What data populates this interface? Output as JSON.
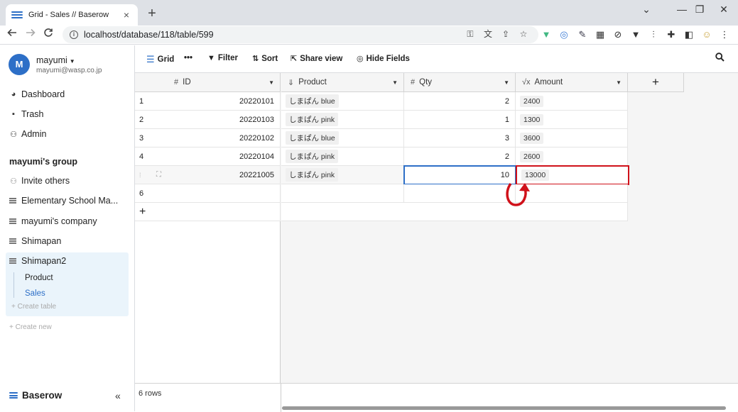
{
  "browser": {
    "tab_title": "Grid - Sales // Baserow",
    "tab_close": "×",
    "new_tab": "+",
    "url": "localhost/database/118/table/599",
    "win_minimize": "—",
    "win_restore": "❐",
    "win_close": "✕",
    "win_chevron": "⌄"
  },
  "sidebar": {
    "avatar_letter": "M",
    "username": "mayumi",
    "email": "mayumi@wasp.co.jp",
    "nav": [
      {
        "label": "Dashboard",
        "icon": "dashboard-icon"
      },
      {
        "label": "Trash",
        "icon": "trash-icon"
      },
      {
        "label": "Admin",
        "icon": "admin-icon"
      }
    ],
    "group_title": "mayumi's group",
    "invite": "Invite others",
    "databases": [
      "Elementary School Ma...",
      "mayumi's company",
      "Shimapan",
      "Shimapan2"
    ],
    "tables": [
      "Product",
      "Sales"
    ],
    "create_table": "Create table",
    "create_new": "Create new",
    "brand": "Baserow",
    "collapse": "«"
  },
  "toolbar": {
    "grid": "Grid",
    "more": "•••",
    "filter": "Filter",
    "sort": "Sort",
    "share": "Share view",
    "hide": "Hide Fields"
  },
  "grid": {
    "columns": {
      "id": "ID",
      "product": "Product",
      "qty": "Qty",
      "amount": "Amount",
      "add": "+"
    },
    "rows": [
      {
        "n": "1",
        "id": "20220101",
        "product": "しまぱん blue",
        "qty": "2",
        "amount": "2400"
      },
      {
        "n": "2",
        "id": "20220103",
        "product": "しまぱん pink",
        "qty": "1",
        "amount": "1300"
      },
      {
        "n": "3",
        "id": "20220102",
        "product": "しまぱん blue",
        "qty": "3",
        "amount": "3600"
      },
      {
        "n": "4",
        "id": "20220104",
        "product": "しまぱん pink",
        "qty": "2",
        "amount": "2600"
      },
      {
        "n": "",
        "id": "20221005",
        "product": "しまぱん pink",
        "qty": "10",
        "amount": "13000"
      },
      {
        "n": "6",
        "id": "",
        "product": "",
        "qty": "",
        "amount": ""
      }
    ],
    "add_row": "+",
    "row_count": "6 rows"
  },
  "colors": {
    "accent": "#2d6fc7",
    "highlight": "#d0111a"
  }
}
